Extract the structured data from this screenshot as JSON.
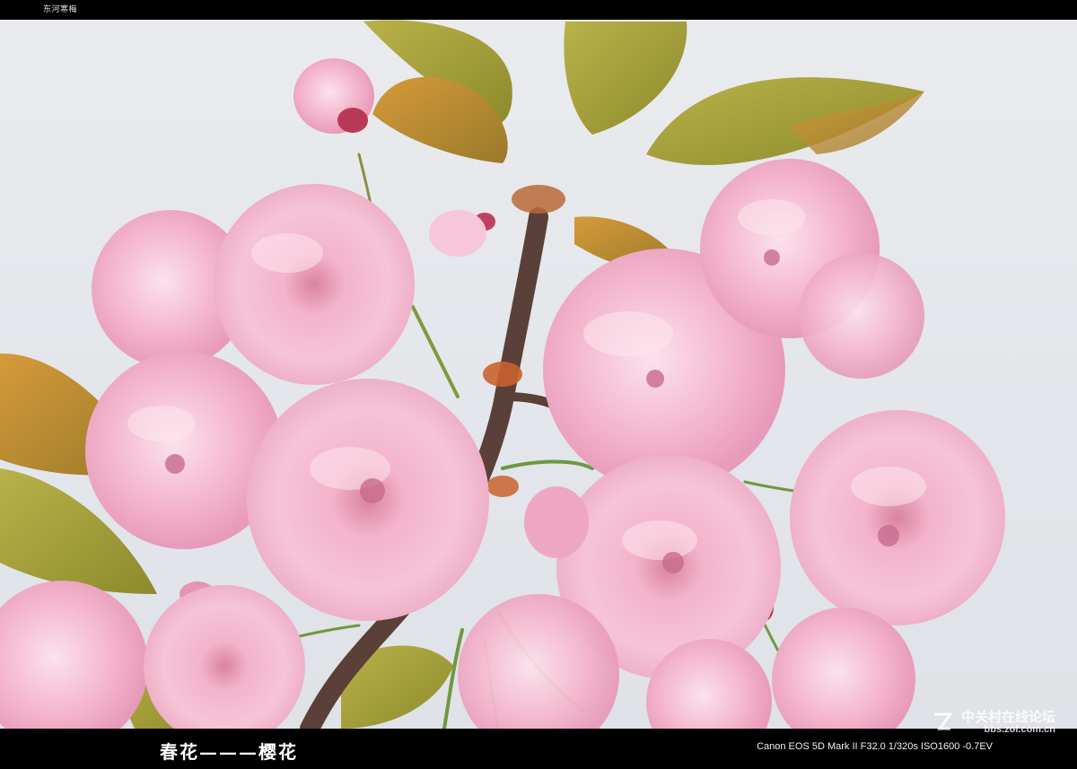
{
  "top_tag": "东河寒梅",
  "caption": "春花———樱花",
  "exif": "Canon EOS 5D Mark II F32.0 1/320s ISO1600 -0.7EV",
  "watermark": {
    "title": "中关村在线论坛",
    "url": "bbs.zol.com.cn"
  },
  "colors": {
    "blossom": "#f2a9c6",
    "blossom_light": "#f8d3e2",
    "leaf": "#a8a338",
    "leaf_orange": "#c9822e",
    "sky": "#e6e8eb",
    "branch": "#5a4038"
  }
}
